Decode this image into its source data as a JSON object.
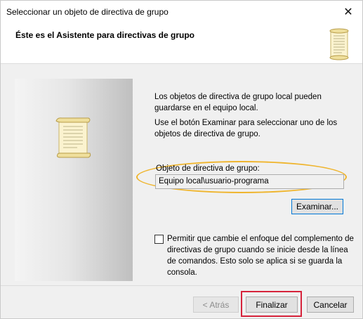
{
  "window": {
    "title": "Seleccionar un objeto de directiva de grupo",
    "close_glyph": "✕"
  },
  "header": {
    "title": "Éste es el Asistente para directivas de grupo",
    "icon": "scroll-icon"
  },
  "content": {
    "paragraph1": "Los objetos de directiva de grupo local pueden guardarse en el equipo local.",
    "paragraph2": "Use el botón Examinar para seleccionar uno de los objetos de directiva de grupo.",
    "gpo_label": "Objeto de directiva de grupo:",
    "gpo_value": "Equipo local\\usuario-programa",
    "browse_label": "Examinar...",
    "checkbox_checked": false,
    "checkbox_label": "Permitir que cambie el enfoque del complemento de directivas de grupo cuando se inicie desde la línea de comandos. Esto solo se aplica si se guarda la consola."
  },
  "footer": {
    "back_label": "< Atrás",
    "finish_label": "Finalizar",
    "cancel_label": "Cancelar"
  },
  "colors": {
    "highlight_oval": "#efb52e",
    "highlight_box": "#d6233b",
    "focus_blue": "#0078d7"
  }
}
